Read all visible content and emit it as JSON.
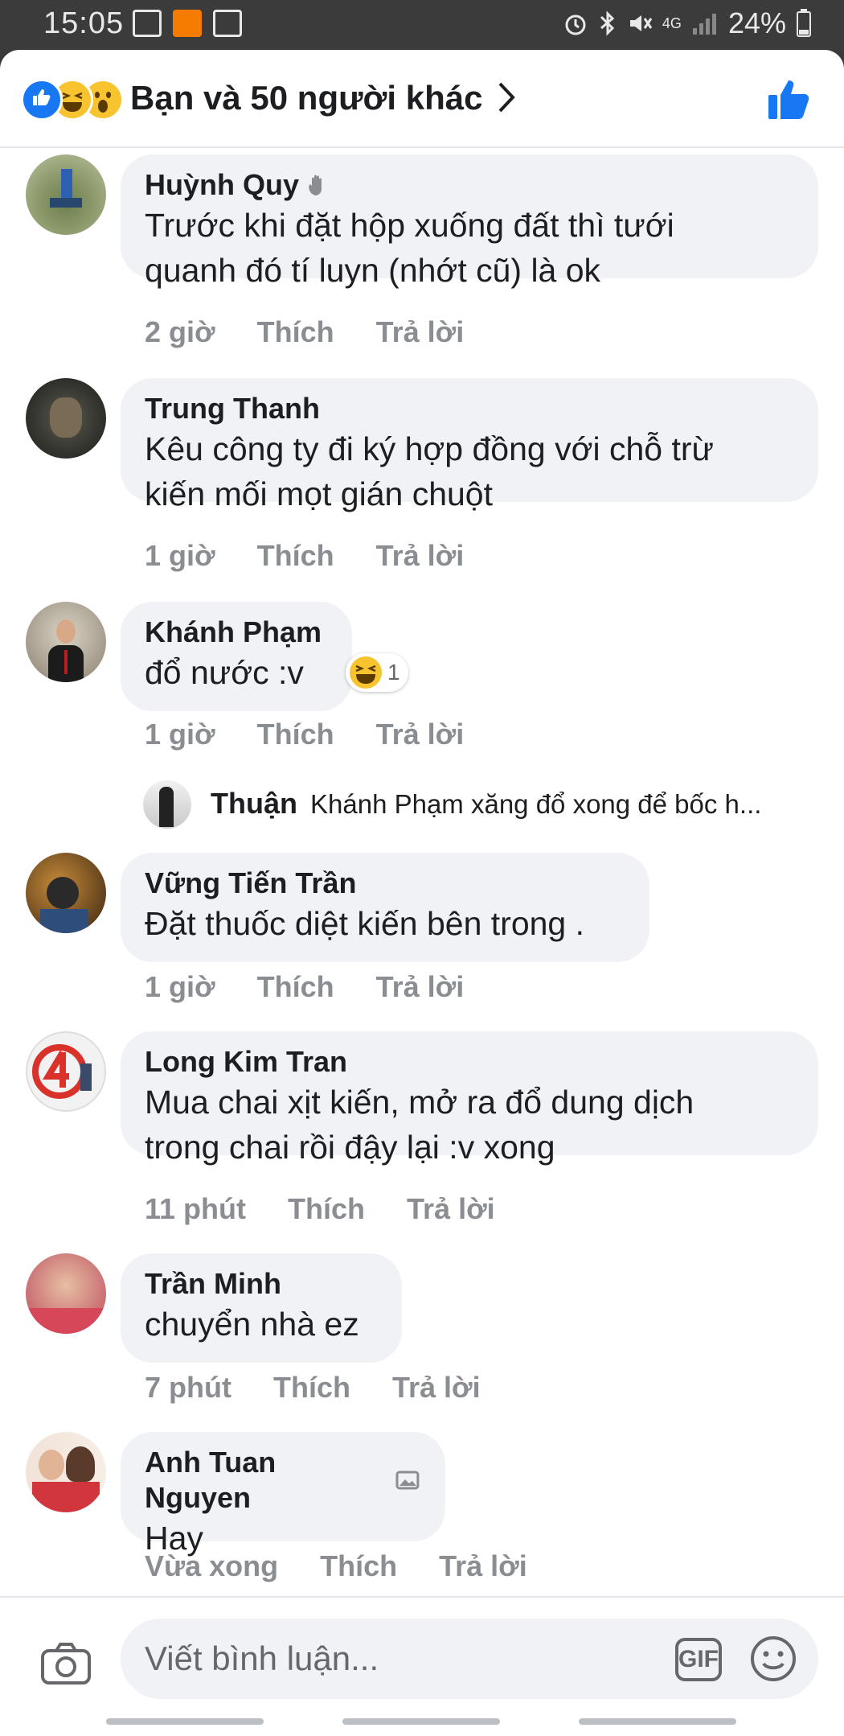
{
  "status_bar": {
    "time": "15:05",
    "battery": "24%",
    "network": "4G"
  },
  "header": {
    "title": "Bạn và 50 người khác",
    "reaction_icons": [
      "like-icon",
      "haha-icon",
      "wow-icon"
    ]
  },
  "comments": [
    {
      "name": "Huỳnh Quy",
      "lines": [
        "Trước khi đặt hộp xuống đất thì tưới",
        "quanh đó tí luyn (nhớt cũ) là ok"
      ],
      "time": "2 giờ",
      "like": "Thích",
      "reply": "Trả lời",
      "badge_icon": "wave-icon"
    },
    {
      "name": "Trung Thanh",
      "lines": [
        "Kêu công ty đi ký hợp đồng với chỗ trừ",
        "kiến mối mọt gián chuột"
      ],
      "time": "1 giờ",
      "like": "Thích",
      "reply": "Trả lời"
    },
    {
      "name": "Khánh Phạm",
      "lines": [
        "đổ nước :v"
      ],
      "time": "1 giờ",
      "like": "Thích",
      "reply": "Trả lời",
      "reaction": {
        "icon": "haha-icon",
        "count": "1"
      }
    },
    {
      "name": "Vững Tiến Trần",
      "lines": [
        "Đặt thuốc diệt kiến bên trong ."
      ],
      "time": "1 giờ",
      "like": "Thích",
      "reply": "Trả lời"
    },
    {
      "name": "Long Kim Tran",
      "lines": [
        "Mua chai xịt kiến, mở ra đổ dung dịch",
        "trong chai rồi đậy lại :v xong"
      ],
      "time": "11 phút",
      "like": "Thích",
      "reply": "Trả lời"
    },
    {
      "name": "Trần Minh",
      "lines": [
        "chuyển nhà ez"
      ],
      "time": "7 phút",
      "like": "Thích",
      "reply": "Trả lời"
    },
    {
      "name": "Anh Tuan Nguyen",
      "lines": [
        "Hay"
      ],
      "time": "Vừa xong",
      "like": "Thích",
      "reply": "Trả lời",
      "badge_icon": "photo-badge-icon"
    }
  ],
  "reply_preview": {
    "name": "Thuận",
    "mention": "Khánh Phạm",
    "text": " xăng đổ xong để bốc h..."
  },
  "composer": {
    "placeholder": "Viết bình luận...",
    "gif_label": "GIF"
  },
  "colors": {
    "accent": "#1877f2",
    "bubble": "#f0f2f5",
    "meta_text": "#8a8d91"
  }
}
